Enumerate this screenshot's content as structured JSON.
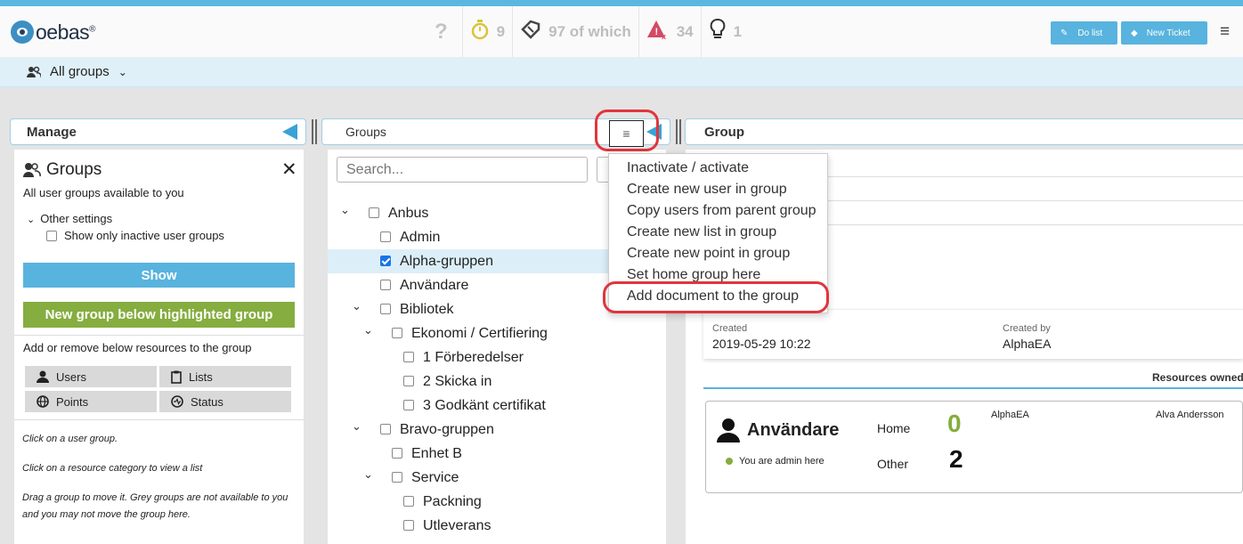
{
  "colors": {
    "accent": "#58b3de",
    "green": "#85ad3f",
    "highlight_ring": "#e0353e",
    "subbar": "#dff0f8"
  },
  "header": {
    "logo": "oebas",
    "logo_mark": "®",
    "stats": [
      {
        "icon": "question-icon",
        "value": ""
      },
      {
        "icon": "stopwatch-icon",
        "value": "9"
      },
      {
        "icon": "ticket-icon",
        "value": "97 of which"
      },
      {
        "icon": "warning-icon",
        "value": "34"
      },
      {
        "icon": "lightbulb-icon",
        "value": "1"
      }
    ],
    "do_list_label": "Do list",
    "new_ticket_label": "New Ticket"
  },
  "subbar": {
    "group_selector": "All groups"
  },
  "manage_panel": {
    "heading": "Manage",
    "title": "Groups",
    "subtitle": "All user groups available to you",
    "other_settings": "Other settings",
    "inactive_only": "Show only inactive user groups",
    "show_button": "Show",
    "new_group_button": "New group below highlighted group",
    "resources_label": "Add or remove below resources to the group",
    "resources": [
      "Users",
      "Lists",
      "Points",
      "Status"
    ],
    "help": [
      "Click on a user group.",
      "Click on a resource category to view a list",
      "Drag a group to move it. Grey groups are not available to you and you may not move the group here."
    ]
  },
  "groups_panel": {
    "heading": "Groups",
    "search_placeholder": "Search...",
    "tree": [
      {
        "label": "Anbus",
        "level": 0,
        "expanded": true,
        "checked": false
      },
      {
        "label": "Admin",
        "level": 1,
        "expanded": null,
        "checked": false
      },
      {
        "label": "Alpha-gruppen",
        "level": 1,
        "expanded": null,
        "checked": true,
        "highlighted": true
      },
      {
        "label": "Användare",
        "level": 1,
        "expanded": null,
        "checked": false
      },
      {
        "label": "Bibliotek",
        "level": 1,
        "expanded": true,
        "checked": false
      },
      {
        "label": "Ekonomi / Certifiering",
        "level": 2,
        "expanded": true,
        "checked": false
      },
      {
        "label": "1 Förberedelser",
        "level": 3,
        "expanded": null,
        "checked": false
      },
      {
        "label": "2 Skicka in",
        "level": 3,
        "expanded": null,
        "checked": false
      },
      {
        "label": "3 Godkänt certifikat",
        "level": 3,
        "expanded": null,
        "checked": false
      },
      {
        "label": "Bravo-gruppen",
        "level": 1,
        "expanded": true,
        "checked": false
      },
      {
        "label": "Enhet B",
        "level": 2,
        "expanded": null,
        "checked": false
      },
      {
        "label": "Service",
        "level": 2,
        "expanded": true,
        "checked": false
      },
      {
        "label": "Packning",
        "level": 3,
        "expanded": null,
        "checked": false
      },
      {
        "label": "Utleverans",
        "level": 3,
        "expanded": null,
        "checked": false
      }
    ]
  },
  "menu": {
    "items": [
      "Inactivate / activate",
      "Create new user in group",
      "Copy users from parent group",
      "Create new list in group",
      "Create new point in group",
      "Set home group here",
      "Add document to the group"
    ]
  },
  "group_panel": {
    "heading": "Group",
    "created_label": "Created",
    "created_value": "2019-05-29 10:22",
    "created_by_label": "Created by",
    "created_by_value": "AlphaEA",
    "resources_owned": "Resources owned b",
    "users_card": {
      "title": "Användare",
      "admin_note": "You are admin here",
      "home_label": "Home",
      "home_count": "0",
      "other_label": "Other",
      "other_count": "2",
      "names": [
        "AlphaEA",
        "Alva Andersson"
      ]
    }
  }
}
